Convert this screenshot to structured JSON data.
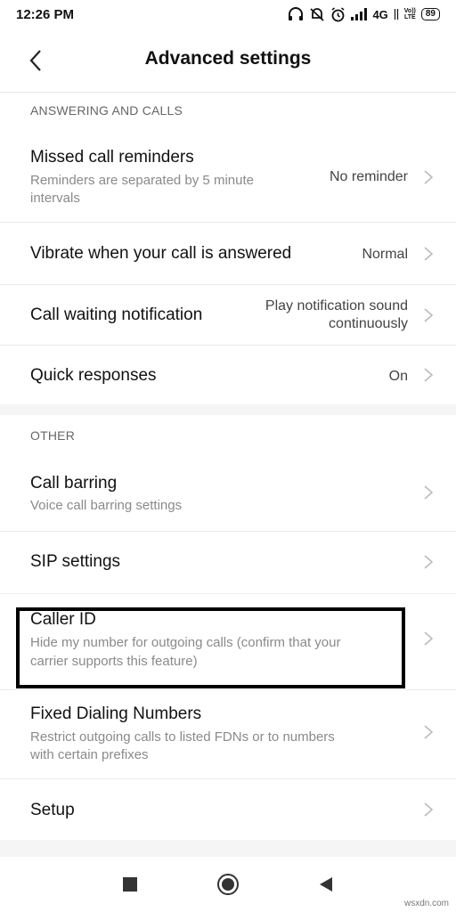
{
  "status_bar": {
    "time": "12:26 PM",
    "network": "4G",
    "volte_top": "Vo))",
    "volte_bottom": "LTE",
    "battery": "89",
    "icons": [
      "headphones-icon",
      "mute-icon",
      "alarm-icon",
      "signal-icon",
      "network-arrows-icon",
      "battery-icon"
    ]
  },
  "header": {
    "title": "Advanced settings",
    "back_icon": "chevron-left-icon"
  },
  "sections": {
    "answering": {
      "title": "ANSWERING AND CALLS"
    },
    "other": {
      "title": "OTHER"
    }
  },
  "rows": {
    "missed_call": {
      "title": "Missed call reminders",
      "sub_line1": "Reminders are separated by 5 minute",
      "sub_line2": "intervals",
      "value": "No reminder"
    },
    "vibrate": {
      "title": "Vibrate when your call is answered",
      "value": "Normal"
    },
    "call_waiting": {
      "title": "Call waiting notification",
      "value_line1": "Play notification sound",
      "value_line2": "continuously"
    },
    "quick_responses": {
      "title": "Quick responses",
      "value": "On"
    },
    "call_barring": {
      "title": "Call barring",
      "sub": "Voice call barring settings"
    },
    "sip": {
      "title": "SIP settings"
    },
    "caller_id": {
      "title": "Caller ID",
      "sub_line1": "Hide my number for outgoing calls (confirm that your",
      "sub_line2": "carrier supports this feature)"
    },
    "fdn": {
      "title": "Fixed Dialing Numbers",
      "sub_line1": "Restrict outgoing calls to listed FDNs or to numbers",
      "sub_line2": "with certain prefixes"
    },
    "setup": {
      "title": "Setup"
    }
  },
  "nav_bar": {
    "icons": [
      "recents-square-icon",
      "home-circle-icon",
      "back-triangle-icon"
    ]
  },
  "watermark": "wsxdn.com",
  "colors": {
    "section_text": "#666666",
    "sub_text": "#8a8a8a",
    "divider": "#ebebeb",
    "band": "#f5f5f5"
  }
}
